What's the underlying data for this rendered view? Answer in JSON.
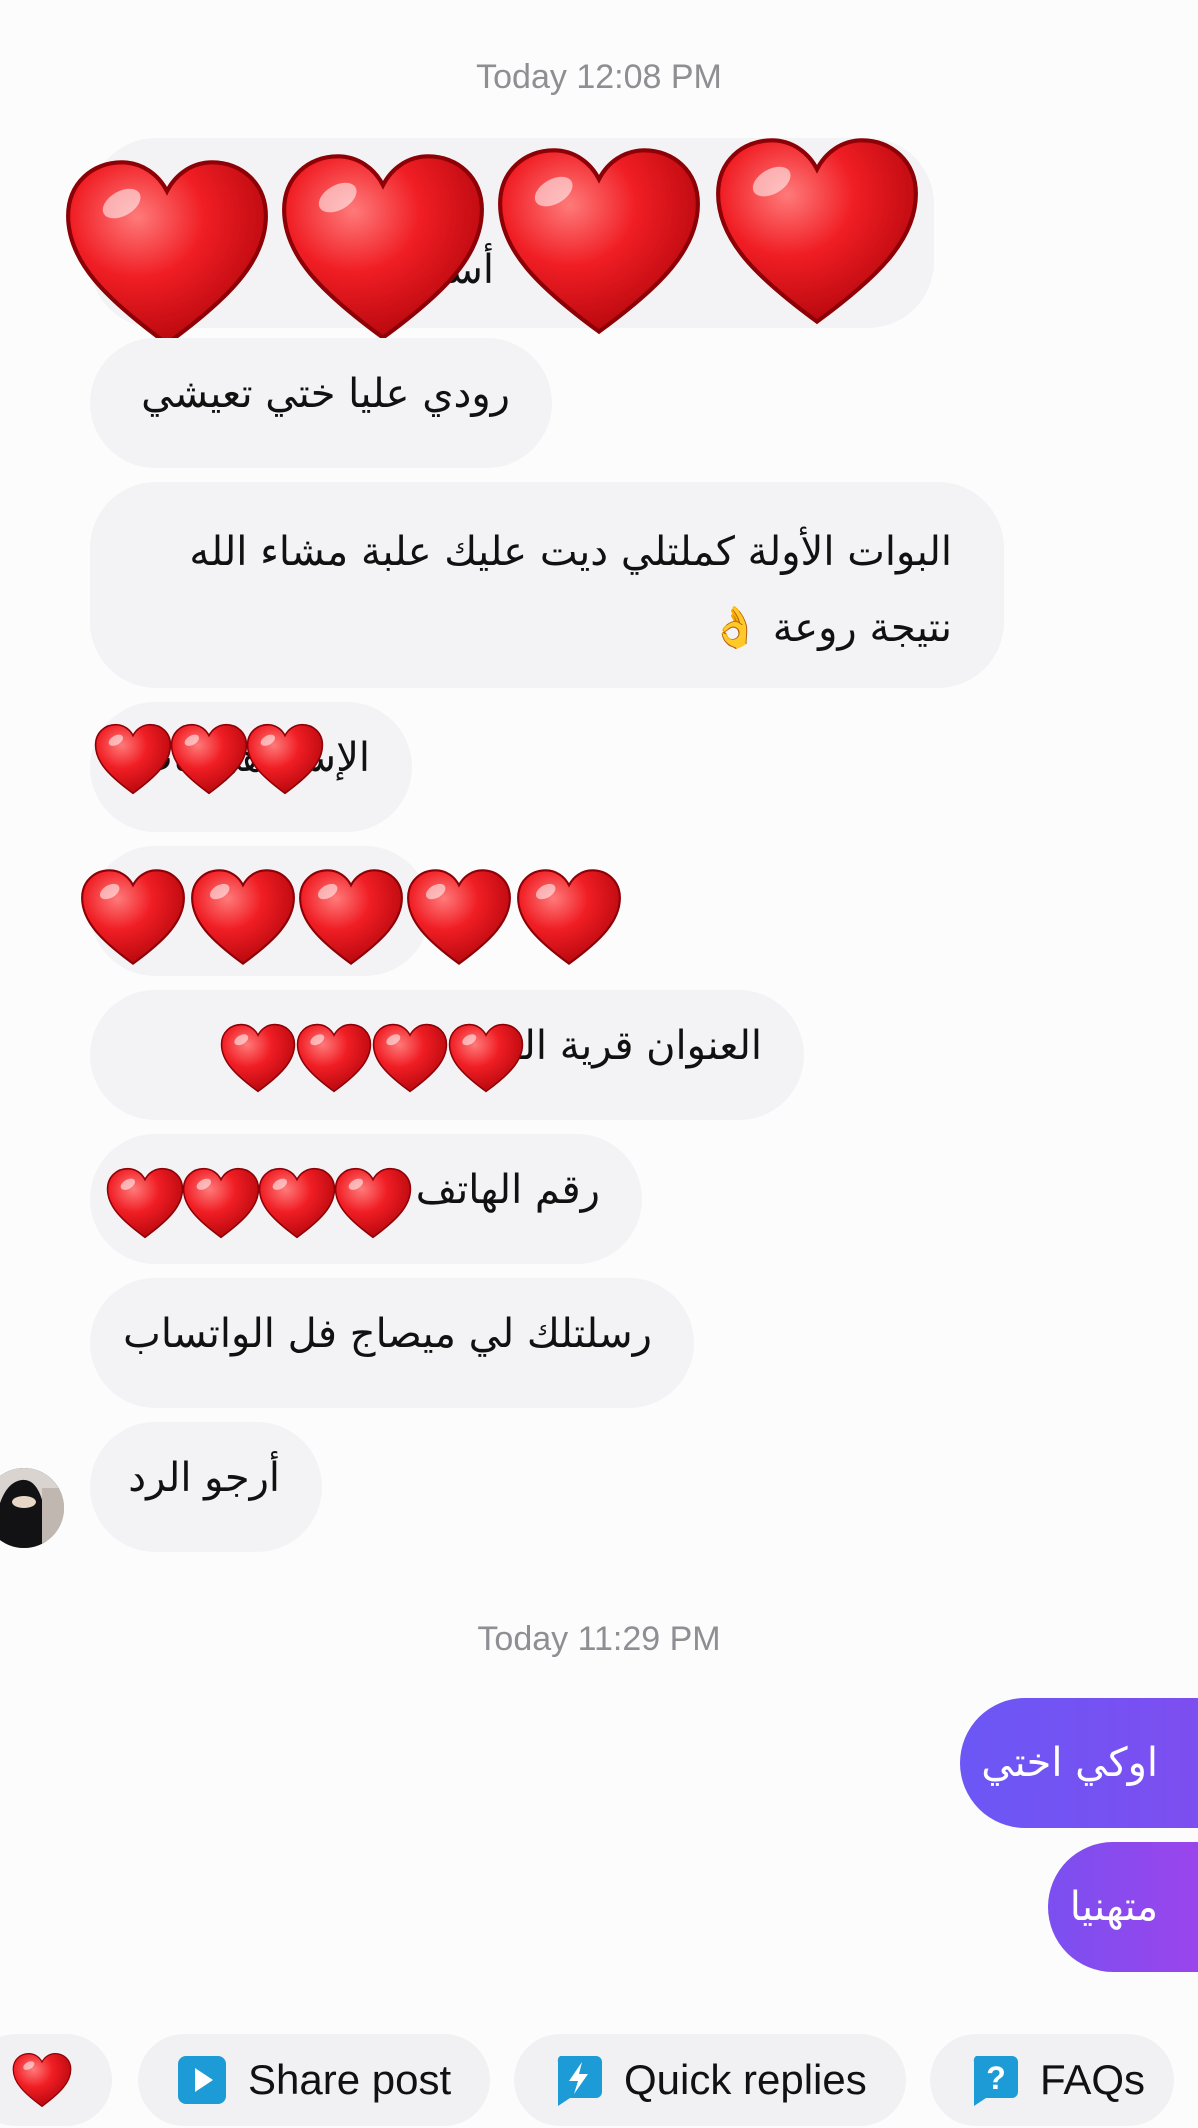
{
  "thread": {
    "timestamp_1": "Today 12:08 PM",
    "timestamp_2": "Today 11:29 PM",
    "incoming": [
      {
        "text": "أسـ وصـ"
      },
      {
        "text": "رودي عليا ختي تعيشي"
      },
      {
        "text": "البوات الأولة كملتلي ديت عليك علبة مشاء الله نتيجة روعة 👌"
      },
      {
        "text": "الإسم هي بات"
      },
      {
        "text": "بـ"
      },
      {
        "text": "العنوان قرية الـ 🤝"
      },
      {
        "text": "رقم الهاتف"
      },
      {
        "text": "رسلتلك لي ميصاج فل الواتساب"
      },
      {
        "text": "أرجو الرد"
      }
    ],
    "outgoing": [
      {
        "text": "اوكي اختي"
      },
      {
        "text": "متهنيا"
      }
    ],
    "redaction": {
      "icon": "heart-icon",
      "color": "#e8141b"
    }
  },
  "quick_bar": {
    "like_icon": "heart-icon",
    "share_label": "Share post",
    "share_icon": "play-square-icon",
    "quick_replies_label": "Quick replies",
    "quick_replies_icon": "lightning-bubble-icon",
    "faqs_label": "FAQs",
    "faqs_icon": "question-bubble-icon",
    "accent_color": "#1d9bd7"
  }
}
